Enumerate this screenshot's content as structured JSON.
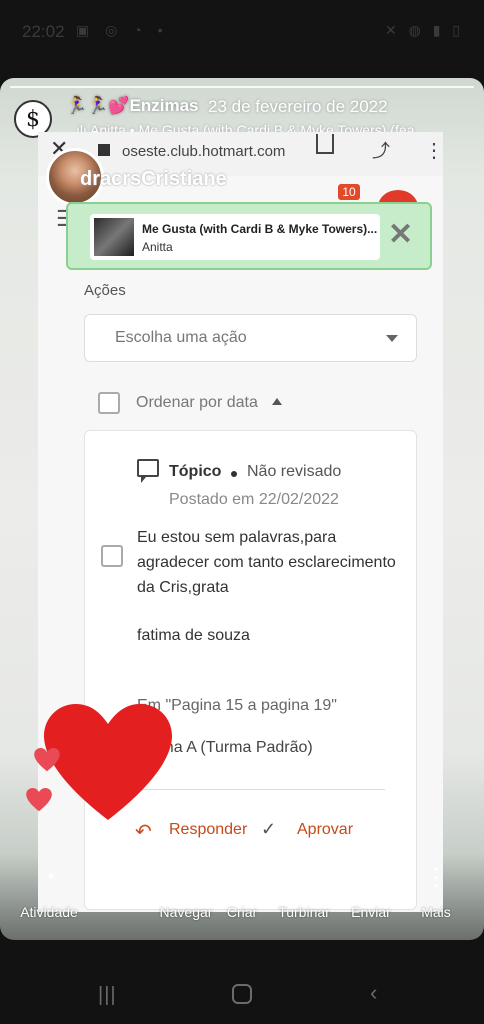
{
  "status_bar": {
    "time": "22:02",
    "left_icons": "▣ ◎ ◔ •",
    "right_icons": "✕ ◍ ▮ ▯"
  },
  "story": {
    "logo_glyph": "$",
    "username": "🏃‍♀️🏃‍♀️💕Enzimas",
    "date": "23 de fevereiro de 2022",
    "music_line": "ılı Anitta • Me Gusta (with Cardi B & Myke Towers) (fea..."
  },
  "browser": {
    "url": "oseste.club.hotmart.com",
    "close_glyph": "✕",
    "share_glyph": "⤴",
    "more_glyph": "⋮"
  },
  "site": {
    "name": "dracrsCristiane",
    "notifications": "10",
    "hamburger_glyph": "☰"
  },
  "music_card": {
    "song_title": "Me Gusta (with Cardi B & Myke Towers)...",
    "artist": "Anitta",
    "close_glyph": "✕"
  },
  "actions": {
    "label": "Ações",
    "select_placeholder": "Escolha uma ação",
    "order_label": "Ordenar por data"
  },
  "post": {
    "type": "Tópico",
    "status": "Não revisado",
    "posted": "Postado em 22/02/2022",
    "body": "Eu estou sem palavras,para agradecer com tanto esclarecimento da Cris,grata",
    "author": "fatima de souza",
    "reference": "Em \"Pagina 15 a pagina 19\"",
    "turma": "Turma A (Turma Padrão)",
    "reply_label": "Responder",
    "approve_label": "Aprovar"
  },
  "bottom_bar": {
    "items": [
      {
        "label": "Atividade",
        "icon": "activity-icon",
        "glyph": "◔"
      },
      {
        "label": "Navegar",
        "icon": "browse-icon",
        "glyph": "▯"
      },
      {
        "label": "Criar",
        "icon": "create-icon",
        "glyph": "▶"
      },
      {
        "label": "Turbinar",
        "icon": "boost-icon",
        "glyph": "↗"
      },
      {
        "label": "Enviar",
        "icon": "send-icon",
        "glyph": "➤"
      },
      {
        "label": "Mais",
        "icon": "more-icon",
        "glyph": "⋮"
      }
    ]
  },
  "nav_bar": {
    "recents_glyph": "|||",
    "back_glyph": "‹"
  },
  "colors": {
    "heart": "#e31f1f",
    "music_card_bg": "#c6ecc9",
    "action_accent": "#c64a1a"
  }
}
